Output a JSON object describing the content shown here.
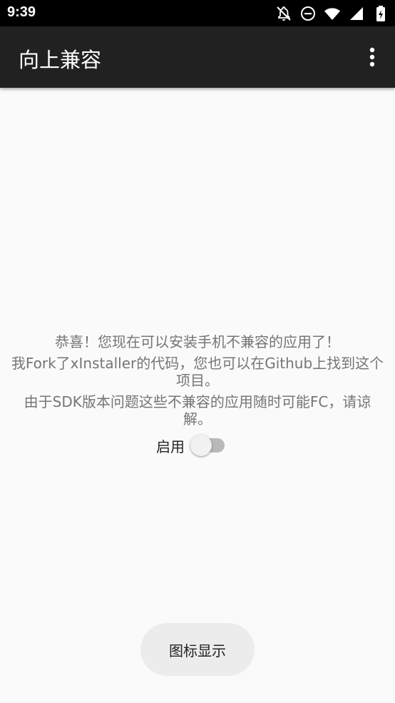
{
  "status_bar": {
    "time": "9:39",
    "icons": [
      "notifications-off-icon",
      "do-not-disturb-icon",
      "wifi-icon",
      "cellular-signal-icon",
      "battery-icon"
    ]
  },
  "app_bar": {
    "title": "向上兼容",
    "overflow_icon": "more-vert-icon"
  },
  "main": {
    "message_line_1": "恭喜！您现在可以安装手机不兼容的应用了！",
    "message_line_2a": "我Fork了xInstaller的代码，您也可以在Github上找到这个",
    "message_line_2b": "项目。",
    "message_line_3a": "由于SDK版本问题这些不兼容的应用随时可能FC，请谅",
    "message_line_3b": "解。",
    "toggle_label": "启用",
    "toggle_on": false
  },
  "bottom_button": {
    "label": "图标显示"
  },
  "colors": {
    "app_bar": "#212121",
    "background": "#fafafa",
    "message_text": "#757575",
    "switch_track": "#b9b9b9",
    "switch_thumb": "#f1f1f1"
  }
}
